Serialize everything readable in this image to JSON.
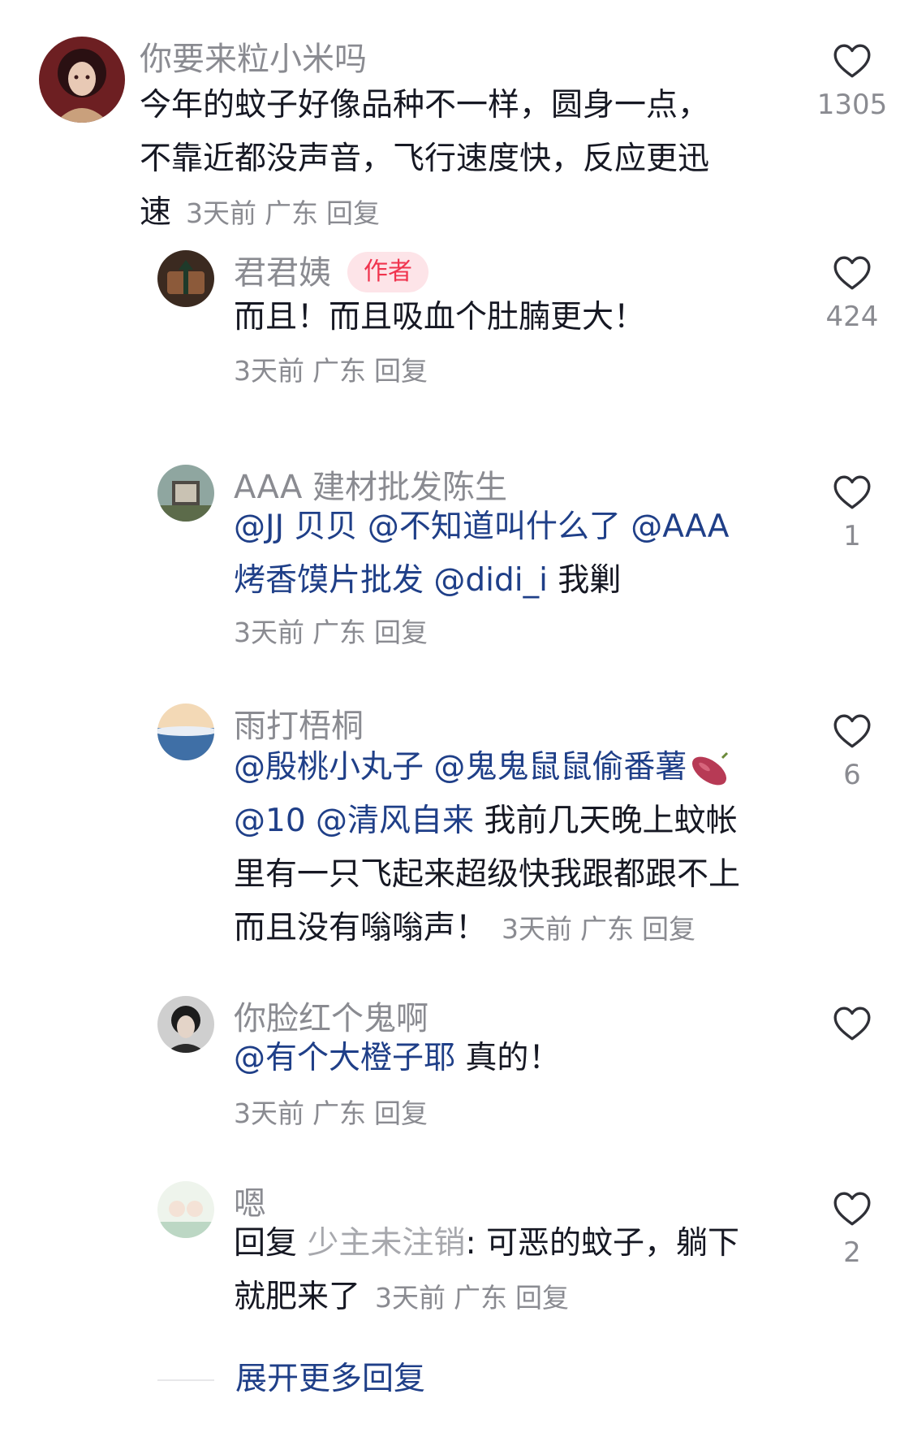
{
  "colors": {
    "username": "#8a8b91",
    "body": "#161823",
    "mention": "#1f3f88",
    "author_badge_bg": "#fde4e8",
    "author_badge_text": "#f0344e"
  },
  "icons": {
    "like": "heart-outline-icon"
  },
  "comments": [
    {
      "username": "你要来粒小米吗",
      "text_lines": [
        "今年的蚊子好像品种不一样，圆身一点，",
        "不靠近都没声音，飞行速度快，反应更迅",
        "速"
      ],
      "time": "3天前",
      "location": "广东",
      "reply_label": "回复",
      "likes": "1305"
    },
    {
      "username": "君君姨",
      "badge": "作者",
      "text": "而且！而且吸血个肚腩更大！",
      "time": "3天前",
      "location": "广东",
      "reply_label": "回复",
      "likes": "424"
    },
    {
      "username": "AAA 建材批发陈生",
      "mentions": [
        "@JJ 贝贝",
        "@不知道叫什么了",
        "@AAA",
        "烤香馍片批发",
        "@didi_i"
      ],
      "text": "我剿",
      "time": "3天前",
      "location": "广东",
      "reply_label": "回复",
      "likes": "1"
    },
    {
      "username": "雨打梧桐",
      "mentions": [
        "@殷桃小丸子",
        "@鬼鬼鼠鼠偷番薯",
        "@10",
        "@清风自来"
      ],
      "emoji": "sweet-potato-emoji",
      "text_a": "我前几天晚上蚊帐",
      "text_b": "里有一只飞起来超级快我跟都跟不上",
      "text_c": "而且没有嗡嗡声！",
      "time": "3天前",
      "location": "广东",
      "reply_label": "回复",
      "likes": "6"
    },
    {
      "username": "你脸红个鬼啊",
      "mentions": [
        "@有个大橙子耶"
      ],
      "text": "真的！",
      "time": "3天前",
      "location": "广东",
      "reply_label": "回复",
      "likes": ""
    },
    {
      "username": "嗯",
      "reply_prefix": "回复",
      "reply_to": "少主未注销",
      "text_a": ": 可恶的蚊子，躺下",
      "text_b": "就肥来了",
      "time": "3天前",
      "location": "广东",
      "reply_label": "回复",
      "likes": "2"
    }
  ],
  "expand_more": "展开更多回复"
}
